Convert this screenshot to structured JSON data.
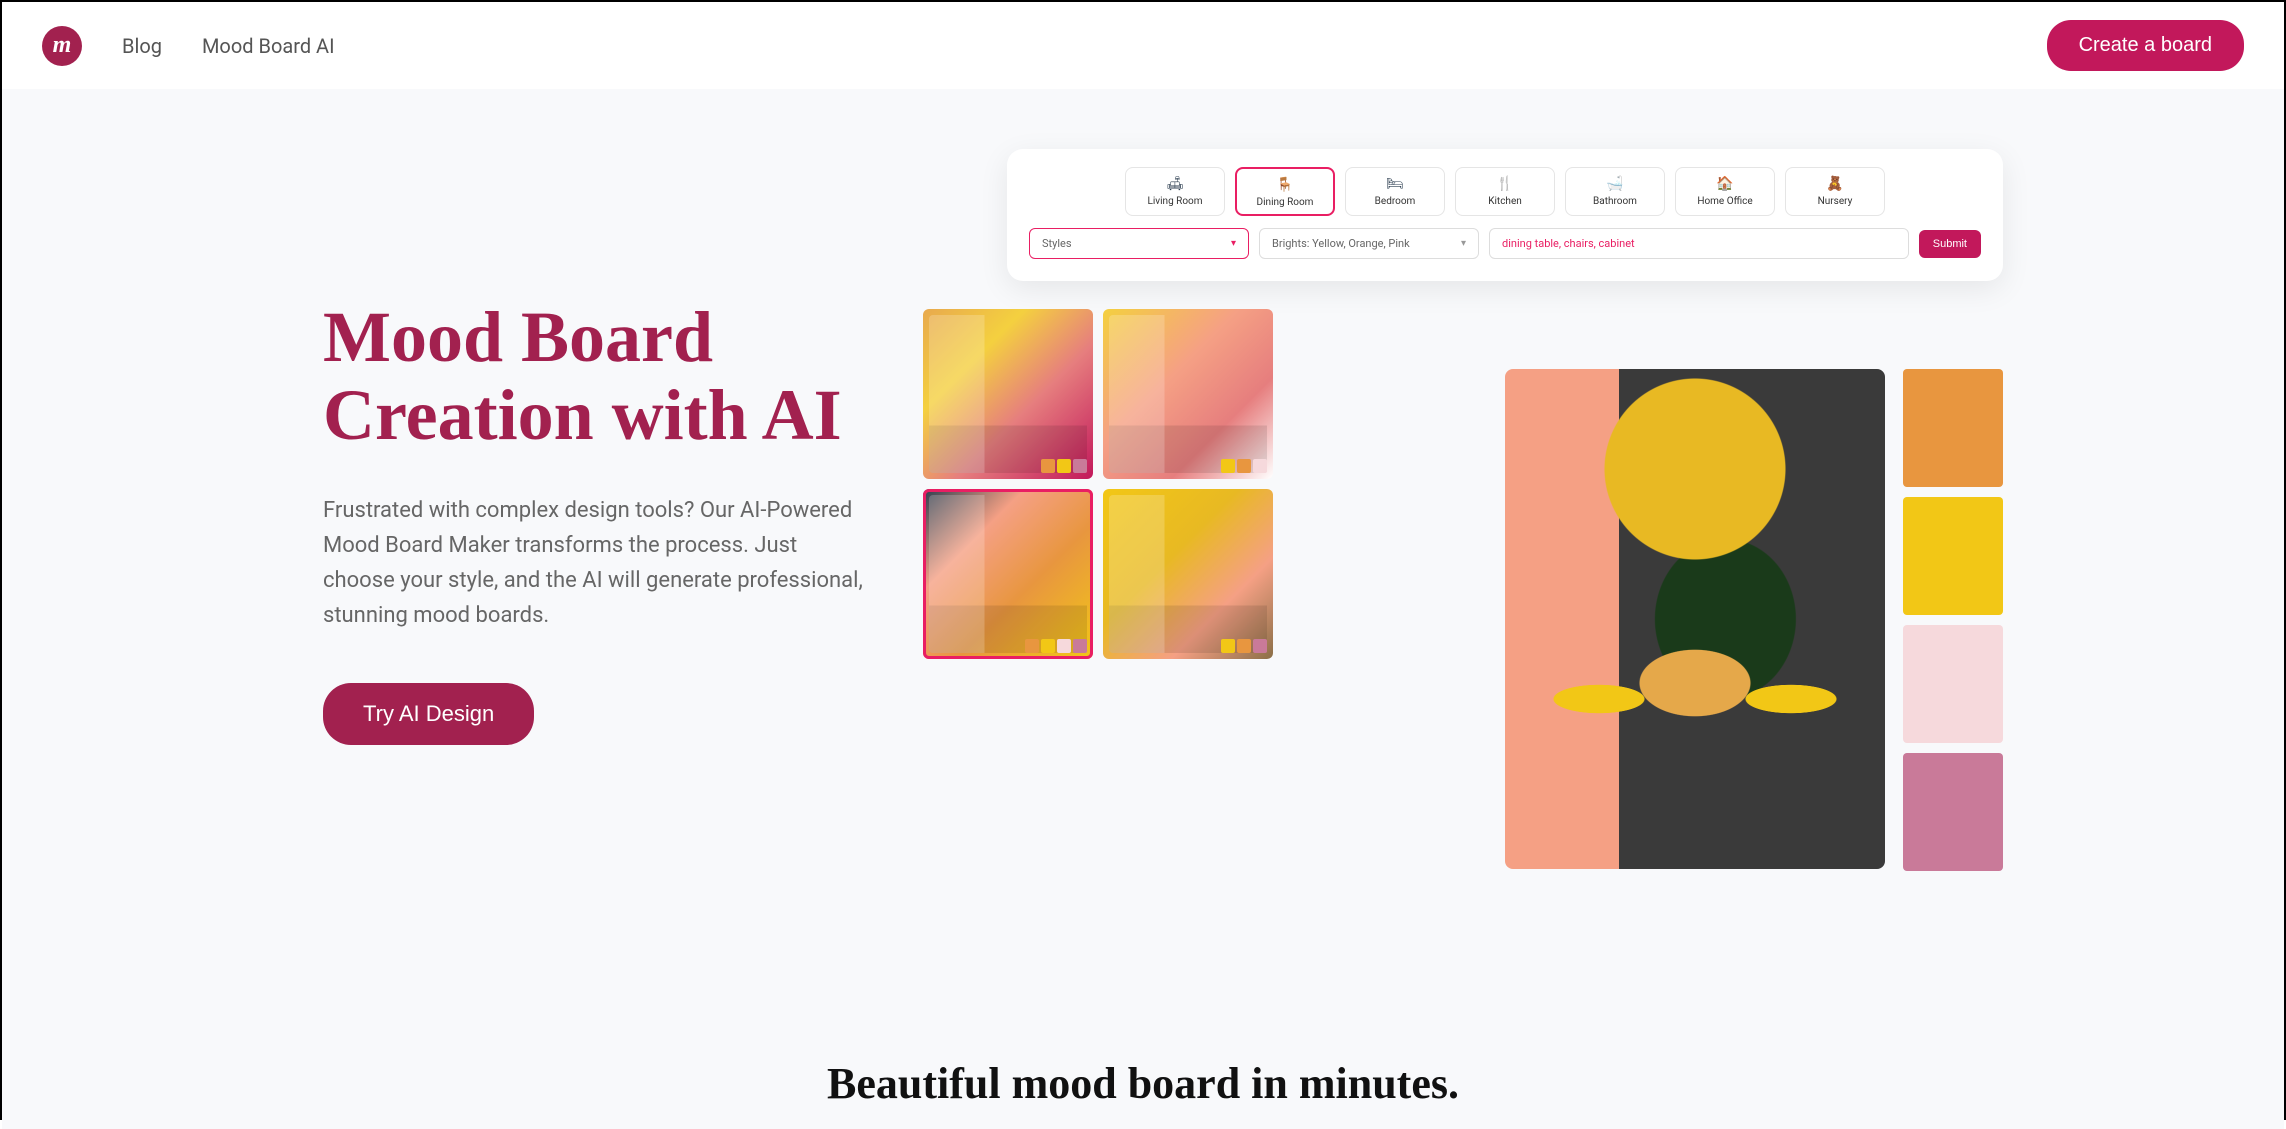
{
  "header": {
    "logo_text": "m",
    "nav": [
      {
        "label": "Blog"
      },
      {
        "label": "Mood Board AI"
      }
    ],
    "cta": "Create a board"
  },
  "hero": {
    "title": "Mood Board Creation with AI",
    "desc": "Frustrated with complex design tools? Our AI-Powered Mood Board Maker transforms the process. Just choose your style, and the AI will generate professional, stunning mood boards.",
    "cta": "Try AI Design"
  },
  "app": {
    "tabs": [
      {
        "label": "Living Room",
        "active": false
      },
      {
        "label": "Dining Room",
        "active": true
      },
      {
        "label": "Bedroom",
        "active": false
      },
      {
        "label": "Kitchen",
        "active": false
      },
      {
        "label": "Bathroom",
        "active": false
      },
      {
        "label": "Home Office",
        "active": false
      },
      {
        "label": "Nursery",
        "active": false
      }
    ],
    "styles_placeholder": "Styles",
    "colors_value": "Brights: Yellow, Orange, Pink",
    "keywords_value": "dining table, chairs, cabinet",
    "submit": "Submit"
  },
  "palette": {
    "c1": "#e8963f",
    "c2": "#f2c716",
    "c3": "#f6d9dc",
    "c4": "#c97a99"
  },
  "section2": {
    "title": "Beautiful mood board in minutes."
  }
}
